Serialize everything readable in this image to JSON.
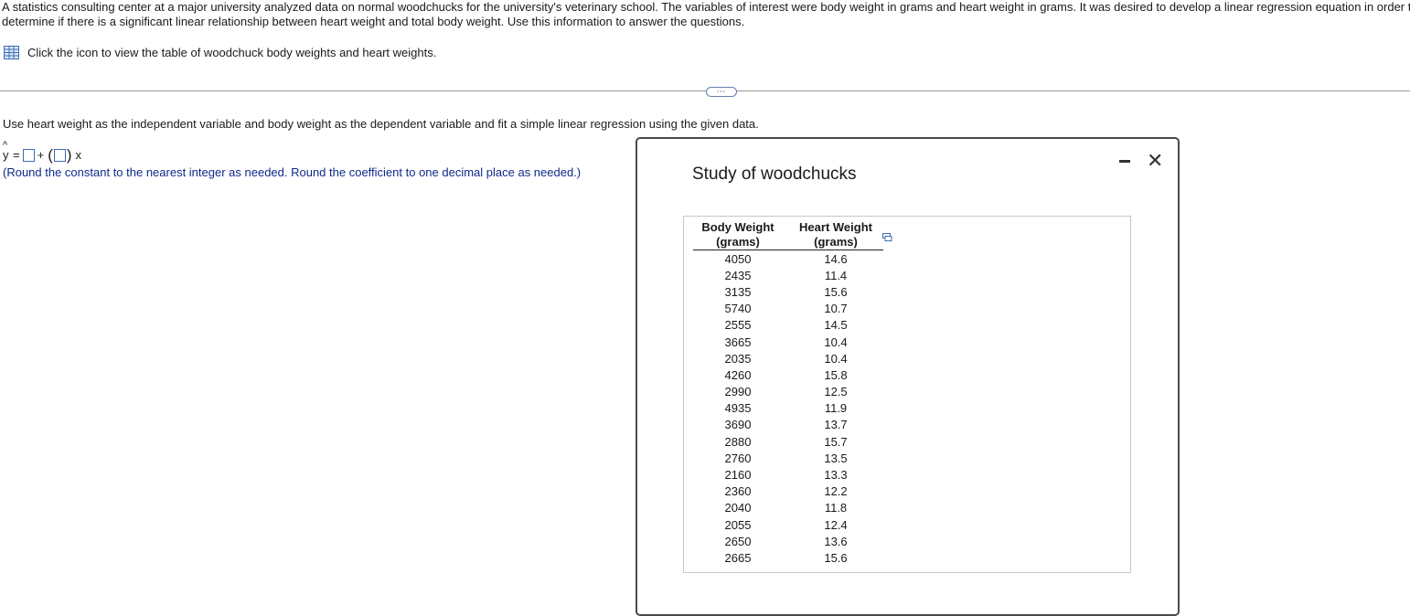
{
  "intro": {
    "line1": "A statistics consulting center at a major university analyzed data on normal woodchucks for the university's veterinary school. The variables of interest were body weight in grams and heart weight in grams. It was desired to develop a linear regression equation in order t",
    "line2": "determine if there is a significant linear relationship between heart weight and total body weight. Use this information to answer the questions."
  },
  "table_link": {
    "icon": "table-grid-icon",
    "label": "Click the icon to view the table of woodchuck body weights and heart weights."
  },
  "expand_label": "⋯",
  "question": {
    "instruction": "Use heart weight as the independent variable and body weight as the dependent variable and fit a simple linear regression using the given data.",
    "y": "y",
    "hat": "^",
    "equals": "=",
    "plus": "+",
    "open_paren": "(",
    "close_paren": ")",
    "x": "x",
    "round_note": "(Round the constant to the nearest integer as needed. Round the coefficient to one decimal place as needed.)"
  },
  "popup": {
    "title": "Study of woodchucks",
    "minimize_icon": "minimize-icon",
    "close_symbol": "✕",
    "headers": [
      {
        "line1": "Body Weight",
        "line2": "(grams)"
      },
      {
        "line1": "Heart Weight",
        "line2": "(grams)"
      }
    ],
    "rows": [
      [
        "4050",
        "14.6"
      ],
      [
        "2435",
        "11.4"
      ],
      [
        "3135",
        "15.6"
      ],
      [
        "5740",
        "10.7"
      ],
      [
        "2555",
        "14.5"
      ],
      [
        "3665",
        "10.4"
      ],
      [
        "2035",
        "10.4"
      ],
      [
        "4260",
        "15.8"
      ],
      [
        "2990",
        "12.5"
      ],
      [
        "4935",
        "11.9"
      ],
      [
        "3690",
        "13.7"
      ],
      [
        "2880",
        "15.7"
      ],
      [
        "2760",
        "13.5"
      ],
      [
        "2160",
        "13.3"
      ],
      [
        "2360",
        "12.2"
      ],
      [
        "2040",
        "11.8"
      ],
      [
        "2055",
        "12.4"
      ],
      [
        "2650",
        "13.6"
      ],
      [
        "2665",
        "15.6"
      ]
    ]
  },
  "colors": {
    "accent": "#3c6eb4",
    "note": "#0f2a8a",
    "border": "#4a4a4a"
  }
}
